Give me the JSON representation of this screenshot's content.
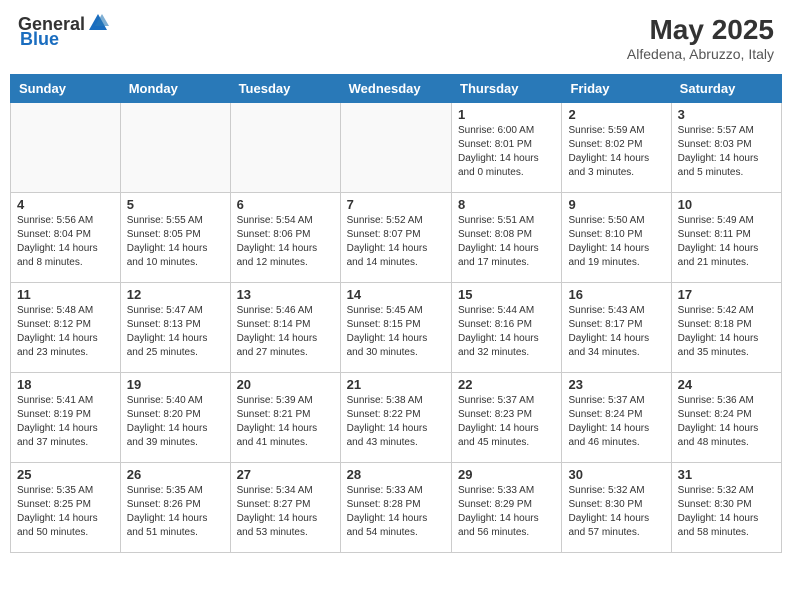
{
  "header": {
    "logo_general": "General",
    "logo_blue": "Blue",
    "month_year": "May 2025",
    "location": "Alfedena, Abruzzo, Italy"
  },
  "days_of_week": [
    "Sunday",
    "Monday",
    "Tuesday",
    "Wednesday",
    "Thursday",
    "Friday",
    "Saturday"
  ],
  "weeks": [
    [
      {
        "day": "",
        "info": ""
      },
      {
        "day": "",
        "info": ""
      },
      {
        "day": "",
        "info": ""
      },
      {
        "day": "",
        "info": ""
      },
      {
        "day": "1",
        "info": "Sunrise: 6:00 AM\nSunset: 8:01 PM\nDaylight: 14 hours\nand 0 minutes."
      },
      {
        "day": "2",
        "info": "Sunrise: 5:59 AM\nSunset: 8:02 PM\nDaylight: 14 hours\nand 3 minutes."
      },
      {
        "day": "3",
        "info": "Sunrise: 5:57 AM\nSunset: 8:03 PM\nDaylight: 14 hours\nand 5 minutes."
      }
    ],
    [
      {
        "day": "4",
        "info": "Sunrise: 5:56 AM\nSunset: 8:04 PM\nDaylight: 14 hours\nand 8 minutes."
      },
      {
        "day": "5",
        "info": "Sunrise: 5:55 AM\nSunset: 8:05 PM\nDaylight: 14 hours\nand 10 minutes."
      },
      {
        "day": "6",
        "info": "Sunrise: 5:54 AM\nSunset: 8:06 PM\nDaylight: 14 hours\nand 12 minutes."
      },
      {
        "day": "7",
        "info": "Sunrise: 5:52 AM\nSunset: 8:07 PM\nDaylight: 14 hours\nand 14 minutes."
      },
      {
        "day": "8",
        "info": "Sunrise: 5:51 AM\nSunset: 8:08 PM\nDaylight: 14 hours\nand 17 minutes."
      },
      {
        "day": "9",
        "info": "Sunrise: 5:50 AM\nSunset: 8:10 PM\nDaylight: 14 hours\nand 19 minutes."
      },
      {
        "day": "10",
        "info": "Sunrise: 5:49 AM\nSunset: 8:11 PM\nDaylight: 14 hours\nand 21 minutes."
      }
    ],
    [
      {
        "day": "11",
        "info": "Sunrise: 5:48 AM\nSunset: 8:12 PM\nDaylight: 14 hours\nand 23 minutes."
      },
      {
        "day": "12",
        "info": "Sunrise: 5:47 AM\nSunset: 8:13 PM\nDaylight: 14 hours\nand 25 minutes."
      },
      {
        "day": "13",
        "info": "Sunrise: 5:46 AM\nSunset: 8:14 PM\nDaylight: 14 hours\nand 27 minutes."
      },
      {
        "day": "14",
        "info": "Sunrise: 5:45 AM\nSunset: 8:15 PM\nDaylight: 14 hours\nand 30 minutes."
      },
      {
        "day": "15",
        "info": "Sunrise: 5:44 AM\nSunset: 8:16 PM\nDaylight: 14 hours\nand 32 minutes."
      },
      {
        "day": "16",
        "info": "Sunrise: 5:43 AM\nSunset: 8:17 PM\nDaylight: 14 hours\nand 34 minutes."
      },
      {
        "day": "17",
        "info": "Sunrise: 5:42 AM\nSunset: 8:18 PM\nDaylight: 14 hours\nand 35 minutes."
      }
    ],
    [
      {
        "day": "18",
        "info": "Sunrise: 5:41 AM\nSunset: 8:19 PM\nDaylight: 14 hours\nand 37 minutes."
      },
      {
        "day": "19",
        "info": "Sunrise: 5:40 AM\nSunset: 8:20 PM\nDaylight: 14 hours\nand 39 minutes."
      },
      {
        "day": "20",
        "info": "Sunrise: 5:39 AM\nSunset: 8:21 PM\nDaylight: 14 hours\nand 41 minutes."
      },
      {
        "day": "21",
        "info": "Sunrise: 5:38 AM\nSunset: 8:22 PM\nDaylight: 14 hours\nand 43 minutes."
      },
      {
        "day": "22",
        "info": "Sunrise: 5:37 AM\nSunset: 8:23 PM\nDaylight: 14 hours\nand 45 minutes."
      },
      {
        "day": "23",
        "info": "Sunrise: 5:37 AM\nSunset: 8:24 PM\nDaylight: 14 hours\nand 46 minutes."
      },
      {
        "day": "24",
        "info": "Sunrise: 5:36 AM\nSunset: 8:24 PM\nDaylight: 14 hours\nand 48 minutes."
      }
    ],
    [
      {
        "day": "25",
        "info": "Sunrise: 5:35 AM\nSunset: 8:25 PM\nDaylight: 14 hours\nand 50 minutes."
      },
      {
        "day": "26",
        "info": "Sunrise: 5:35 AM\nSunset: 8:26 PM\nDaylight: 14 hours\nand 51 minutes."
      },
      {
        "day": "27",
        "info": "Sunrise: 5:34 AM\nSunset: 8:27 PM\nDaylight: 14 hours\nand 53 minutes."
      },
      {
        "day": "28",
        "info": "Sunrise: 5:33 AM\nSunset: 8:28 PM\nDaylight: 14 hours\nand 54 minutes."
      },
      {
        "day": "29",
        "info": "Sunrise: 5:33 AM\nSunset: 8:29 PM\nDaylight: 14 hours\nand 56 minutes."
      },
      {
        "day": "30",
        "info": "Sunrise: 5:32 AM\nSunset: 8:30 PM\nDaylight: 14 hours\nand 57 minutes."
      },
      {
        "day": "31",
        "info": "Sunrise: 5:32 AM\nSunset: 8:30 PM\nDaylight: 14 hours\nand 58 minutes."
      }
    ]
  ]
}
